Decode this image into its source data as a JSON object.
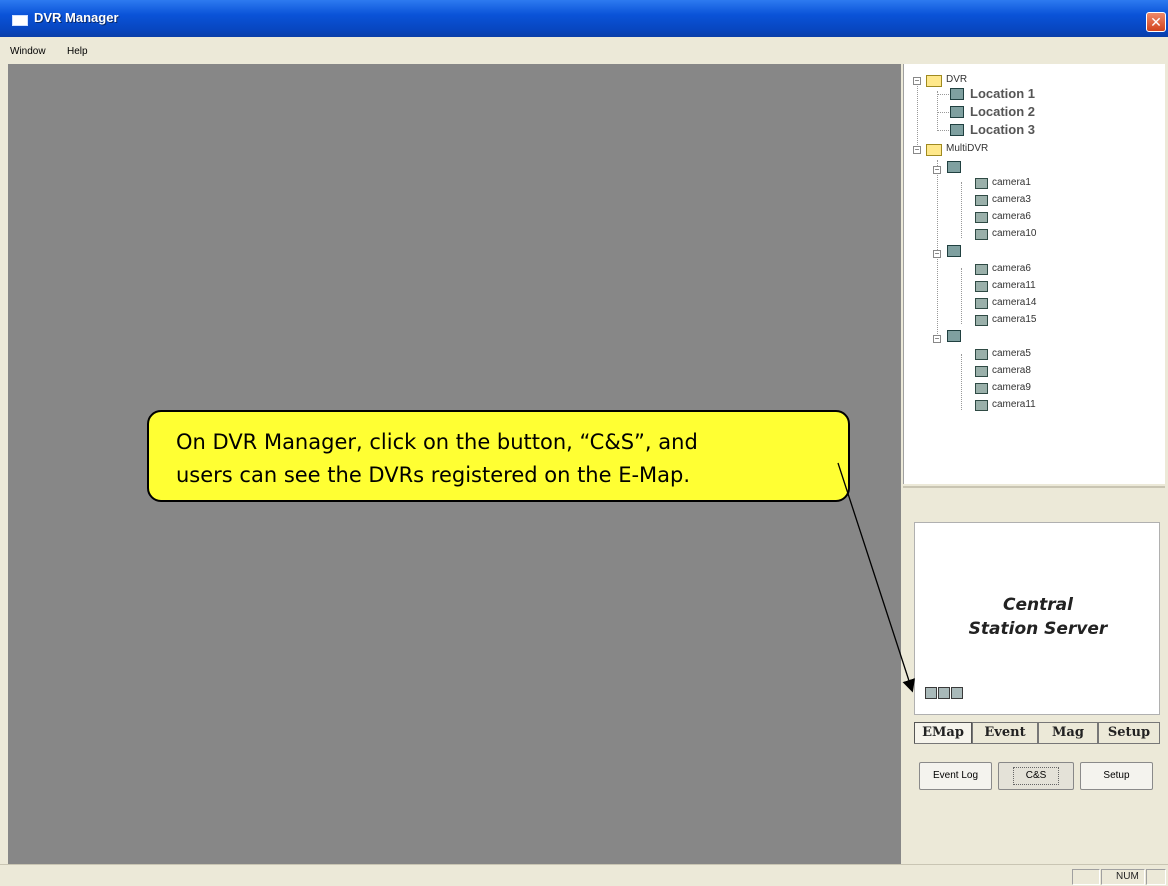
{
  "window": {
    "title": "DVR Manager",
    "close_glyph": "✕"
  },
  "menu": [
    "Window",
    "Help"
  ],
  "tree": {
    "dvr_group": {
      "label": "DVR",
      "children": [
        "Location 1",
        "Location 2",
        "Location 3"
      ]
    },
    "multidvr_group": {
      "label": "MultiDVR",
      "dvrs": [
        {
          "cameras": [
            "camera1",
            "camera3",
            "camera6",
            "camera10"
          ]
        },
        {
          "cameras": [
            "camera6",
            "camera11",
            "camera14",
            "camera15"
          ]
        },
        {
          "cameras": [
            "camera5",
            "camera8",
            "camera9",
            "camera11"
          ]
        }
      ]
    }
  },
  "station": {
    "line1": "Central",
    "line2": "Station Server"
  },
  "tabs": [
    "EMap",
    "Event",
    "Mag",
    "Setup"
  ],
  "buttons": {
    "event_log": "Event Log",
    "cs": "C&S",
    "setup": "Setup"
  },
  "status": {
    "num": "NUM"
  },
  "callout": {
    "line1": "On DVR Manager, click on the button, “C&S”, and",
    "line2": "users can see the DVRs registered on the E-Map."
  },
  "colors": {
    "callout_bg": "#ffff33",
    "titlebar": "#0a53d8",
    "workspace": "#878787"
  }
}
